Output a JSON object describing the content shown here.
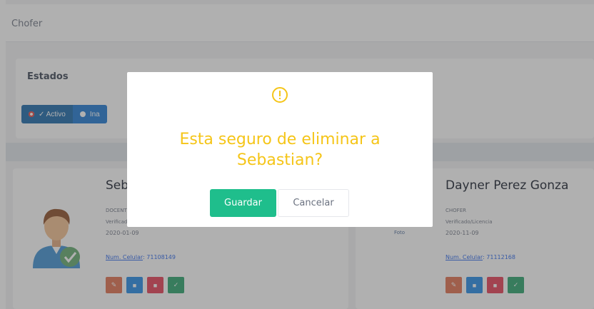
{
  "header": {
    "title": "Chofer"
  },
  "estados": {
    "title": "Estados",
    "buttons": [
      {
        "label": "✓ Activo"
      },
      {
        "label": "Ina"
      }
    ]
  },
  "cards": [
    {
      "name": "Sebastian",
      "line1": "DOCENTE",
      "line2": "Verificado",
      "date": "2020-01-09",
      "phone_label": "Num. Celular",
      "phone_value": "71108149"
    },
    {
      "name": "Dayner Perez Gonza",
      "line1": "CHOFER",
      "line2": "Verificado/Licencia",
      "date": "2020-11-09",
      "phone_label": "Num. Celular",
      "phone_value": "71112168",
      "image_alt": "Foto"
    }
  ],
  "dialog": {
    "message": "Esta seguro de eliminar a Sebastian?",
    "confirm_label": "Guardar",
    "cancel_label": "Cancelar",
    "icon": "warning-circle-icon",
    "message_color": "#f5c518",
    "confirm_color": "#1fbe8c"
  }
}
